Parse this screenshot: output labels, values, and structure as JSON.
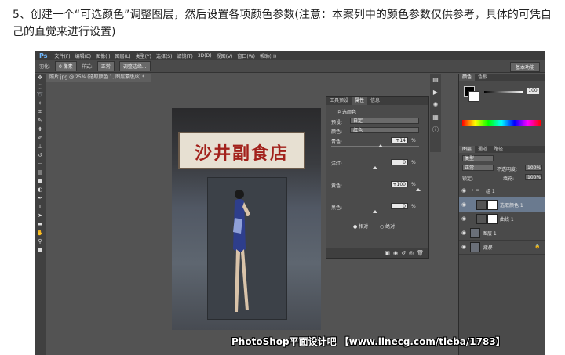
{
  "caption": "5、创建一个“可选颜色”调整图层，然后设置各项颜色参数(注意：本案列中的颜色参数仅供参考，具体的可凭自己的直觉来进行设置)",
  "app": {
    "logo": "Ps",
    "menu": [
      "文件(F)",
      "编辑(E)",
      "图像(I)",
      "图层(L)",
      "类型(Y)",
      "选择(S)",
      "滤镜(T)",
      "3D(D)",
      "视图(V)",
      "窗口(W)",
      "帮助(H)"
    ],
    "options": {
      "feather_label": "羽化:",
      "feather_value": "0 像素",
      "style_label": "样式:",
      "style_value": "正常",
      "refine_edge": "调整边缘..."
    },
    "workspace": "基本功能"
  },
  "document": {
    "tab": "照片.jpg @ 25% (选取颜色 1, 图层蒙版/8) *",
    "sign_text": "沙井副食店"
  },
  "properties_panel": {
    "tabs": [
      "工具预设",
      "属性",
      "信息"
    ],
    "title": "可选颜色",
    "preset_label": "预设:",
    "preset_value": "自定",
    "colors_label": "颜色:",
    "colors_value": "红色",
    "sliders": [
      {
        "label": "青色:",
        "value": "+14"
      },
      {
        "label": "洋红:",
        "value": "0"
      },
      {
        "label": "黄色:",
        "value": "+100"
      },
      {
        "label": "黑色:",
        "value": "0"
      }
    ],
    "percent": "%",
    "relative": "相对",
    "absolute": "绝对"
  },
  "right_panels": {
    "color_tabs": [
      "颜色",
      "色板"
    ],
    "color_value": "100",
    "layer_tabs": [
      "图层",
      "通道",
      "路径"
    ],
    "type_filter": "类型",
    "blend_mode": "正常",
    "opacity_label": "不透明度:",
    "opacity_value": "100%",
    "lock_label": "锁定:",
    "fill_label": "填充:",
    "fill_value": "100%",
    "layers": [
      {
        "name": "组 1",
        "selected": false
      },
      {
        "name": "选取颜色 1",
        "selected": true
      },
      {
        "name": "曲线 1",
        "selected": false
      },
      {
        "name": "图层 1",
        "selected": false
      },
      {
        "name": "背景",
        "selected": false
      }
    ]
  },
  "watermark": "PhotoShop平面设计吧 【www.linecg.com/tieba/1783】"
}
